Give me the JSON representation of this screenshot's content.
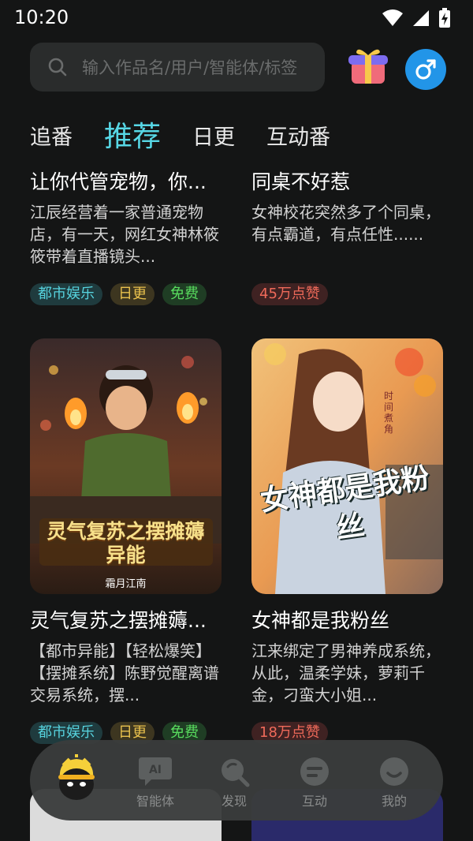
{
  "status": {
    "time": "10:20"
  },
  "search": {
    "placeholder": "输入作品名/用户/智能体/标签"
  },
  "tabs": [
    {
      "label": "追番",
      "active": false
    },
    {
      "label": "推荐",
      "active": true
    },
    {
      "label": "日更",
      "active": false
    },
    {
      "label": "互动番",
      "active": false
    }
  ],
  "cards": [
    {
      "title": "让你代管宠物，你...",
      "desc": "江辰经营着一家普通宠物店，有一天，网红女神林筱筱带着直播镜头...",
      "tags": [
        "都市娱乐",
        "日更",
        "免费"
      ]
    },
    {
      "title": "同桌不好惹",
      "desc": "女神校花突然多了个同桌，有点霸道，有点任性......",
      "tags": [
        "45万点赞"
      ]
    },
    {
      "title": "灵气复苏之摆摊薅...",
      "desc": "【都市异能】【轻松爆笑】【摆摊系统】陈野觉醒离谱交易系统，摆...",
      "tags": [
        "都市娱乐",
        "日更",
        "免费"
      ],
      "cover_text": "灵气复苏之摆摊薅异能",
      "cover_author": "霜月江南"
    },
    {
      "title": "女神都是我粉丝",
      "desc": "江来绑定了男神养成系统，从此，温柔学妹，萝莉千金，刁蛮大小姐...",
      "tags": [
        "18万点赞"
      ],
      "cover_text": "女神都是我粉丝",
      "cover_sub": "时间煮角"
    }
  ],
  "nav": [
    {
      "label": "",
      "icon": "mascot-icon"
    },
    {
      "label": "智能体",
      "icon": "ai-icon"
    },
    {
      "label": "发现",
      "icon": "discover-icon"
    },
    {
      "label": "互动",
      "icon": "interact-icon"
    },
    {
      "label": "我的",
      "icon": "profile-icon"
    }
  ],
  "colors": {
    "accent": "#57d8e6",
    "gender_button": "#2295e8",
    "background": "#141515"
  }
}
